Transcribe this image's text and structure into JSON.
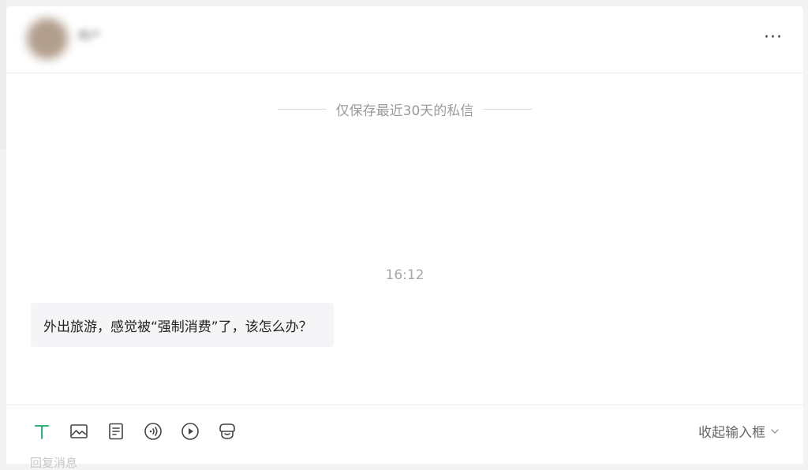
{
  "header": {
    "username": "用户",
    "more_label": "···"
  },
  "chat": {
    "retention_notice": "仅保存最近30天的私信",
    "timestamp": "16:12",
    "messages": [
      {
        "text": "外出旅游，感觉被“强制消费”了，该怎么办？"
      }
    ]
  },
  "input": {
    "tools": [
      "text-icon",
      "image-icon",
      "document-icon",
      "voice-icon",
      "video-icon",
      "shop-icon"
    ],
    "active_tool_color": "#2bb37a",
    "icon_color": "#444444",
    "collapse_label": "收起输入框",
    "placeholder": "回复消息"
  }
}
